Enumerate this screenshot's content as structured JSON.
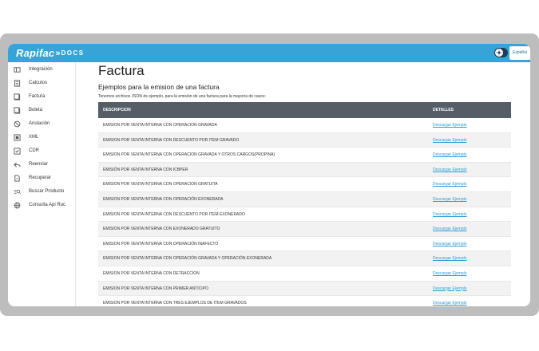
{
  "header": {
    "logo_main": "Rapifac",
    "logo_arrow": "»",
    "logo_docs": "DOCS",
    "language": "Español",
    "accent_color": "#36a4d6"
  },
  "sidebar": {
    "items": [
      {
        "label": "Integración",
        "icon": "integration-icon"
      },
      {
        "label": "Calculos",
        "icon": "calculator-icon"
      },
      {
        "label": "Factura",
        "icon": "document-icon"
      },
      {
        "label": "Boleta",
        "icon": "receipt-icon"
      },
      {
        "label": "Anulación",
        "icon": "cancel-icon"
      },
      {
        "label": "XML",
        "icon": "code-icon"
      },
      {
        "label": "CDR",
        "icon": "file-check-icon"
      },
      {
        "label": "Reenviar",
        "icon": "reply-icon"
      },
      {
        "label": "Recuperar",
        "icon": "recover-icon"
      },
      {
        "label": "Buscar Producto",
        "icon": "search-product-icon"
      },
      {
        "label": "Consulta Api Ruc",
        "icon": "globe-icon"
      }
    ]
  },
  "main": {
    "title": "Factura",
    "subtitle": "Ejemplos para la emision de una factura",
    "description": "Tenemos archivos JSON de ejemplo, para la emisión de una factura para la mayoría de casos:",
    "table": {
      "headers": {
        "description": "DESCRIPCION",
        "details": "DETALLES"
      },
      "rows": [
        {
          "description": "EMISION POR VENTA INTERNA CON OPERACION GRAVADA",
          "link": "Descargar Ejemplo"
        },
        {
          "description": "EMISION POR VENTA INTERNA CON DESCUENTO POR ITEM GRAVADO",
          "link": "Descargar Ejemplo"
        },
        {
          "description": "EMISION POR VENTA INTERNA CON OPERACION GRAVADA Y OTROS CARGOS(PROPINA)",
          "link": "Descargar Ejemplo"
        },
        {
          "description": "EMISIÓN POR VENTA INTERNA CON ICBPER",
          "link": "Descargar Ejemplo"
        },
        {
          "description": "EMISION POR VENTA INTERNA CON OPERACION GRATUITA",
          "link": "Descargar Ejemplo"
        },
        {
          "description": "EMISION POR VENTA INTERNA CON OPERACIÓN EXONERADA",
          "link": "Descargar Ejemplo"
        },
        {
          "description": "EMISION POR VENTA INTERNA CON DESCUENTO POR ITEM EXONERADO",
          "link": "Descargar Ejemplo"
        },
        {
          "description": "EMISION POR VENTA INTERNA CON EXONERADO GRATUITO",
          "link": "Descargar Ejemplo"
        },
        {
          "description": "EMISION POR VENTA INTERNA CON OPERACIÓN INAFECTO",
          "link": "Descargar Ejemplo"
        },
        {
          "description": "EMISION POR VENTA INTERNA CON OPERACIÓN GRAVADA Y OPERACIÓN EXONERADA",
          "link": "Descargar Ejemplo"
        },
        {
          "description": "EMISION POR VENTA INTERNA CON DETRACCION",
          "link": "Descargar Ejemplo"
        },
        {
          "description": "EMISION POR VENTA INTERNA CON PRIMER ANTICIPO",
          "link": "Descargar Ejemplo"
        },
        {
          "description": "EMISION POR VENTA INTERNA CON TRES EJEMPLOS DE ITEM GRAVADOS",
          "link": "Descargar Ejemplo"
        }
      ]
    }
  }
}
